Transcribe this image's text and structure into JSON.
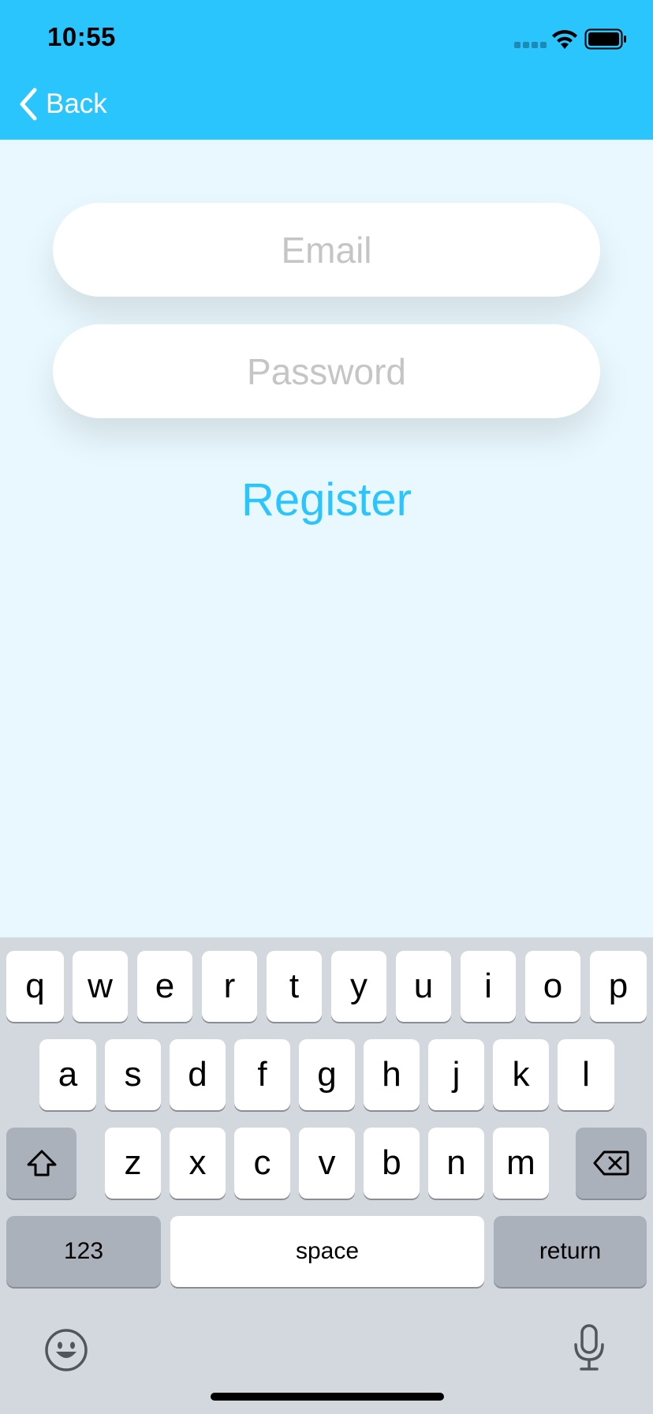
{
  "status_bar": {
    "time": "10:55"
  },
  "nav": {
    "back_label": "Back"
  },
  "form": {
    "email_placeholder": "Email",
    "email_value": "",
    "password_placeholder": "Password",
    "password_value": "",
    "register_label": "Register"
  },
  "keyboard": {
    "row1": [
      "q",
      "w",
      "e",
      "r",
      "t",
      "y",
      "u",
      "i",
      "o",
      "p"
    ],
    "row2": [
      "a",
      "s",
      "d",
      "f",
      "g",
      "h",
      "j",
      "k",
      "l"
    ],
    "row3": [
      "z",
      "x",
      "c",
      "v",
      "b",
      "n",
      "m"
    ],
    "numbers_label": "123",
    "space_label": "space",
    "return_label": "return"
  },
  "colors": {
    "accent": "#2ac5fd",
    "background": "#e9f8fe",
    "keyboard_bg": "#d3d7de",
    "dark_key": "#abb1bb"
  },
  "icons": [
    "back-chevron-icon",
    "signal-icon",
    "wifi-icon",
    "battery-icon",
    "shift-icon",
    "delete-icon",
    "emoji-icon",
    "mic-icon"
  ]
}
